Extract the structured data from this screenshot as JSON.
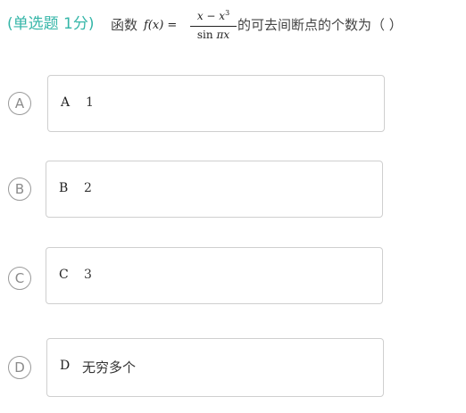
{
  "question": {
    "tag": "(单选题 1分)",
    "text_before": "函数",
    "formula": {
      "lhs": "f(x) =",
      "numerator_base": "x − x",
      "numerator_exponent": "3",
      "denominator_func": "sin ",
      "denominator_arg": "πx"
    },
    "text_after": "的可去间断点的个数为（ ）"
  },
  "options": [
    {
      "circle": "A",
      "letter": "A",
      "text": "1"
    },
    {
      "circle": "B",
      "letter": "B",
      "text": "2"
    },
    {
      "circle": "C",
      "letter": "C",
      "text": "3"
    },
    {
      "circle": "D",
      "letter": "D",
      "text": "无穷多个"
    }
  ],
  "colors": {
    "tag": "#35b6a8",
    "box_border": "#cfcfcf",
    "circle_border": "#9a9a9a"
  }
}
